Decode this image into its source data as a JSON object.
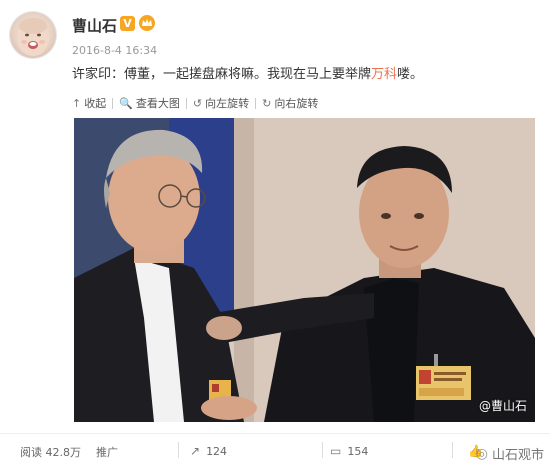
{
  "header": {
    "username": "曹山石",
    "verified_badge": "V",
    "timestamp": "2016-8-4 16:34",
    "avatar_icon": "baby-avatar"
  },
  "post": {
    "text_before": "许家印：傅董，一起搓盘麻将嘛。我现在马上要举牌",
    "highlight": "万科",
    "text_after": "喽。",
    "highlight_color": "#eb7350"
  },
  "actions": [
    {
      "icon": "↑",
      "label": "收起"
    },
    {
      "icon": "🔍",
      "label": "查看大图"
    },
    {
      "icon": "↺",
      "label": "向左旋转"
    },
    {
      "icon": "↻",
      "label": "向右旋转"
    }
  ],
  "photo": {
    "watermark": "@曹山石"
  },
  "footer": {
    "reads": "阅读 42.8万",
    "promote": "推广",
    "reposts": "124",
    "comments": "154",
    "likes": "",
    "corner_logo": "山石观市"
  }
}
